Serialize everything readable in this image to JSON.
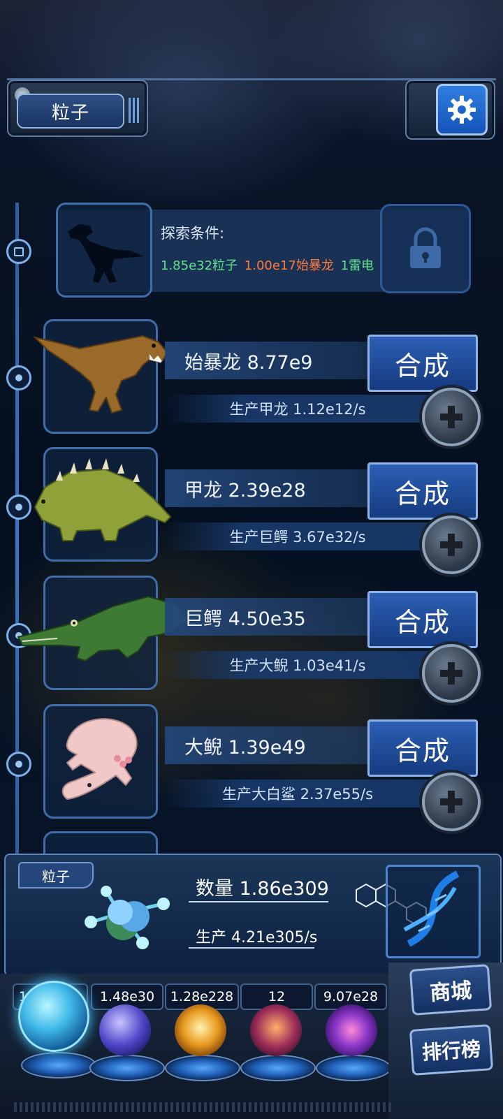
{
  "header": {
    "title": "粒子",
    "settings_icon": "gear-icon"
  },
  "locked_card": {
    "label": "探索条件:",
    "conditions": [
      {
        "text": "1.85e32粒子",
        "color": "#5fe08a"
      },
      {
        "text": "1.00e17始暴龙",
        "color": "#ff7a3c"
      },
      {
        "text": "1雷电",
        "color": "#5fe08a"
      }
    ],
    "lock_icon": "lock-icon"
  },
  "creatures": [
    {
      "name": "始暴龙 8.77e9",
      "production": "生产甲龙 1.12e12/s",
      "button": "合成",
      "icon": "t-rex-icon"
    },
    {
      "name": "甲龙 2.39e28",
      "production": "生产巨鳄 3.67e32/s",
      "button": "合成",
      "icon": "ankylosaurus-icon"
    },
    {
      "name": "巨鳄 4.50e35",
      "production": "生产大鲵 1.03e41/s",
      "button": "合成",
      "icon": "crocodile-icon"
    },
    {
      "name": "大鲵 1.39e49",
      "production": "生产大白鲨 2.37e55/s",
      "button": "合成",
      "icon": "salamander-icon"
    }
  ],
  "resource_panel": {
    "tab": "粒子",
    "quantity": "数量 1.86e309",
    "production": "生产 4.21e305/s",
    "molecule_icon": "molecule-icon",
    "dna_icon": "dna-icon"
  },
  "resource_bar": [
    {
      "value": "1.86e309",
      "icon": "particle-orb-icon",
      "selected": true
    },
    {
      "value": "1.48e30",
      "icon": "lightning-orb-icon"
    },
    {
      "value": "1.28e228",
      "icon": "fire-orb-icon"
    },
    {
      "value": "12",
      "icon": "brain-orb-icon"
    },
    {
      "value": "9.07e28",
      "icon": "vortex-orb-icon"
    }
  ],
  "side_buttons": {
    "shop": "商城",
    "ranking": "排行榜"
  },
  "colors": {
    "accent": "#2f7fe0",
    "frame": "#5d7fa8",
    "condition_green": "#5fe08a",
    "condition_orange": "#ff7a3c"
  }
}
